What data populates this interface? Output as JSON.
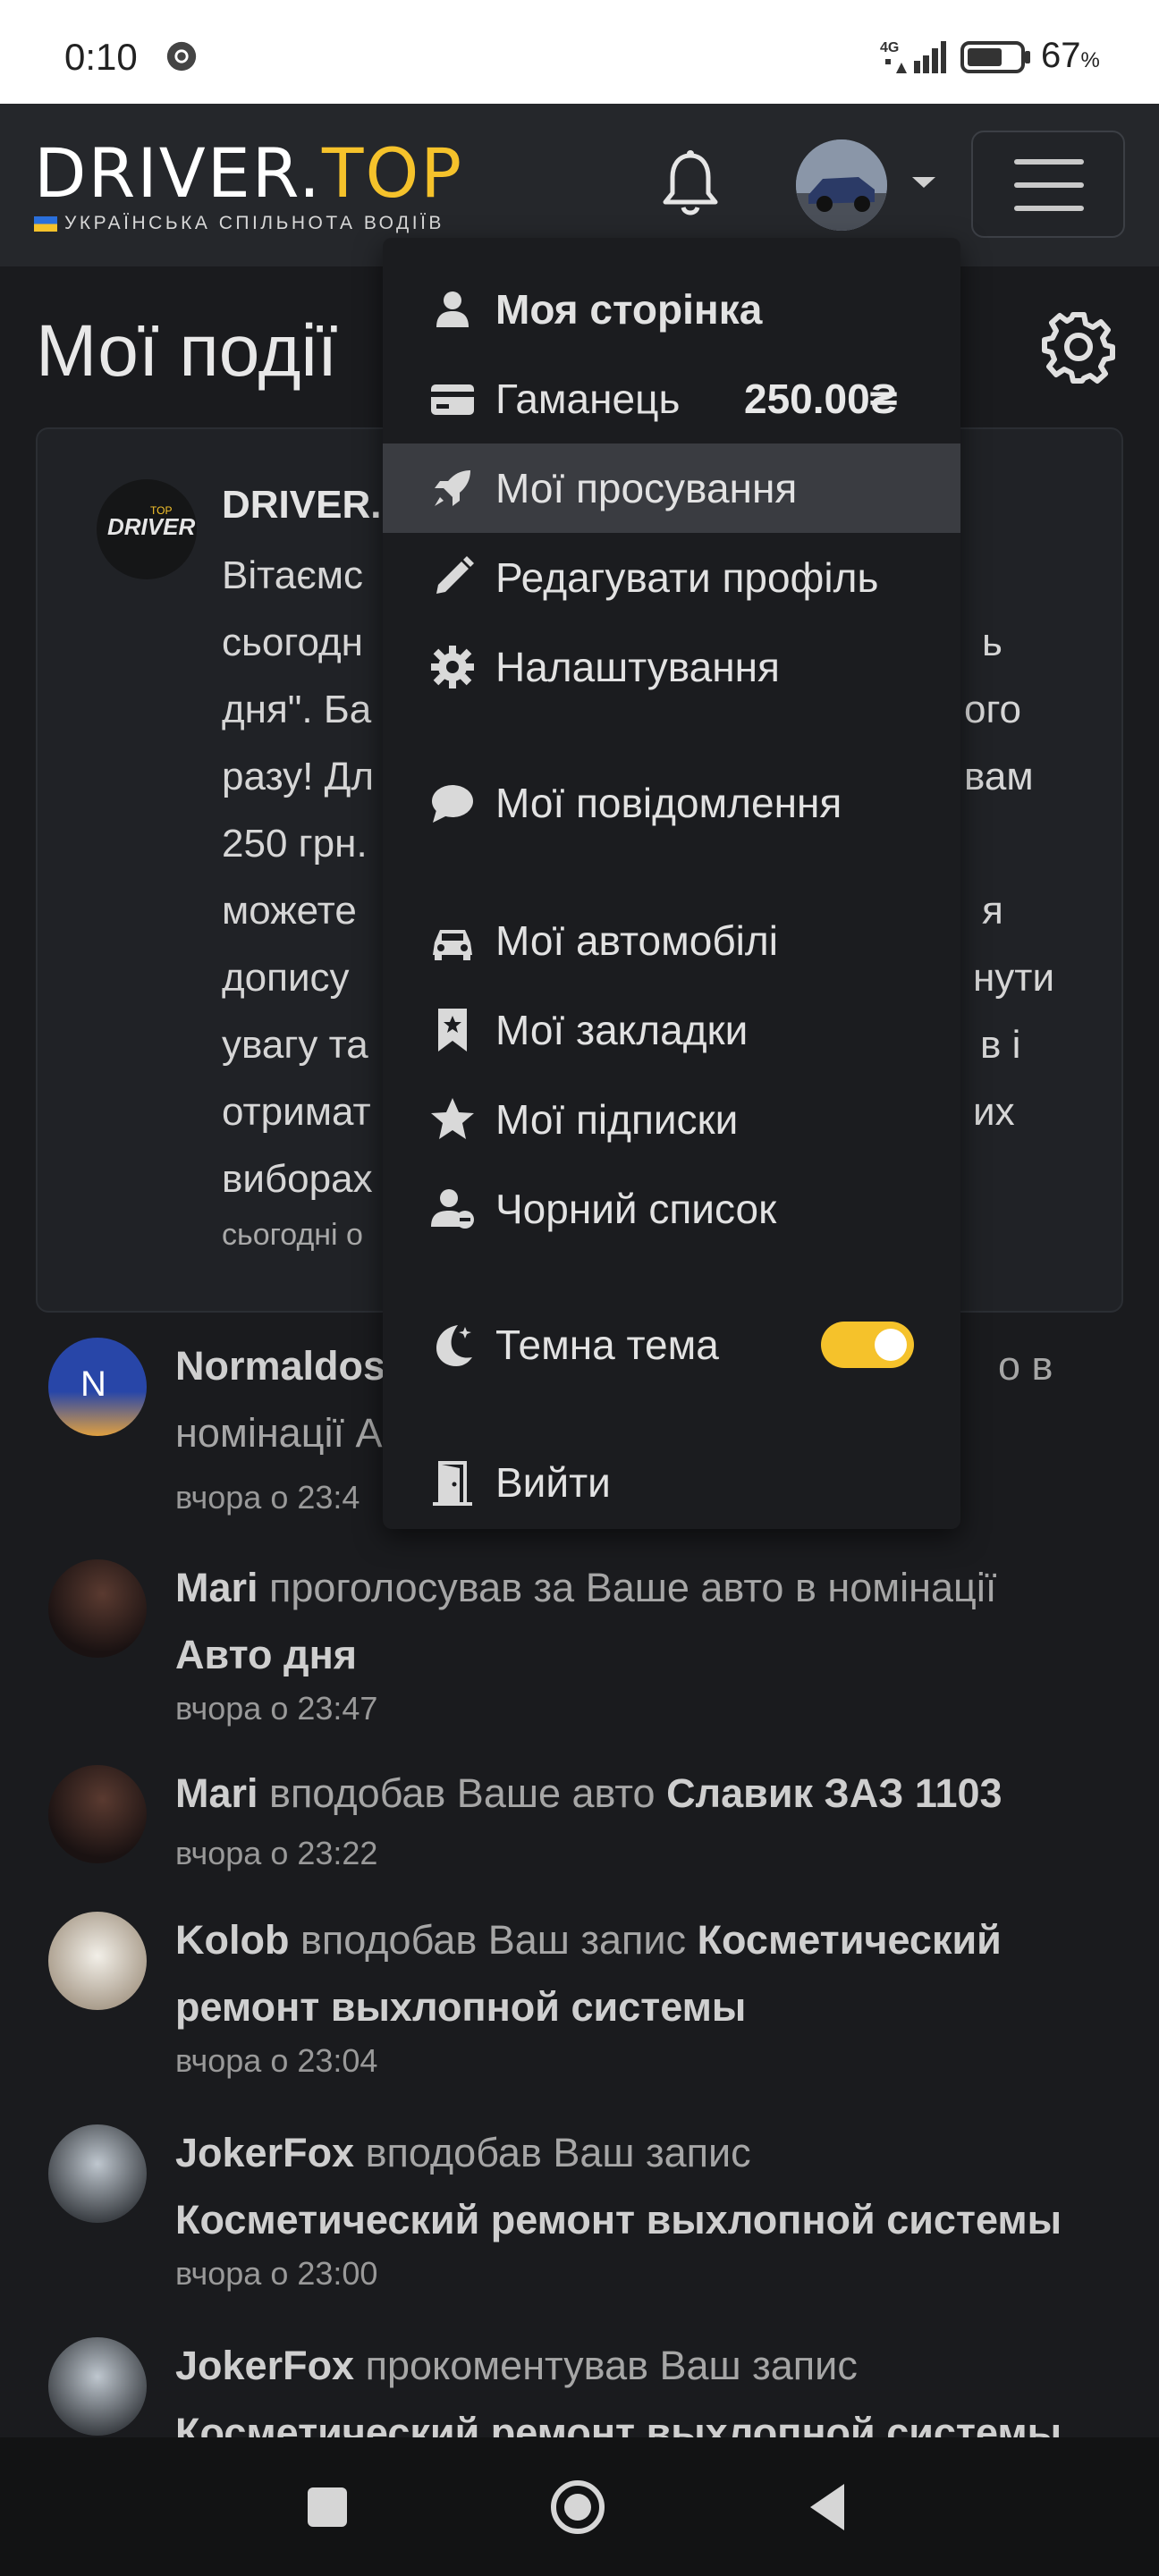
{
  "status_bar": {
    "time": "0:10",
    "network": "4G",
    "battery": "67",
    "battery_unit": "%"
  },
  "header": {
    "logo_left": "DRIVER.",
    "logo_right": "TOP",
    "tagline": "УКРАЇНСЬКА СПІЛЬНОТА ВОДІЇВ",
    "bell_icon": "bell-icon",
    "menu_icon": "hamburger-icon"
  },
  "page": {
    "title": "Мої події",
    "settings_icon": "gear-icon"
  },
  "card": {
    "author": "DRIVER.",
    "badge_text": "DRIVER",
    "badge_top": "TOP",
    "lines": [
      "Вітаємс",
      "сьогодн",
      "дня\". Ба",
      "разу! Дл",
      "250 грн.",
      "можете",
      "допису",
      "увагу та",
      "отримат",
      "виборах"
    ],
    "right_lines": [
      "",
      "ь",
      "ого",
      "вам",
      "",
      "я",
      "нути",
      "в і",
      "их",
      ""
    ],
    "time": "сьогодні о"
  },
  "feed": [
    {
      "user": "Normaldos",
      "action": "",
      "tail": "о в",
      "line2": "номінації А",
      "target": "",
      "time": "вчора о 23:4",
      "avatar": "N"
    },
    {
      "user": "Mari",
      "action": " проголосував за Ваше авто в номінації ",
      "target": "Авто дня",
      "time": "вчора о 23:47"
    },
    {
      "user": "Mari",
      "action": " вподобав Ваше авто ",
      "target": "Славик ЗАЗ 1103",
      "time": "вчора о 23:22"
    },
    {
      "user": "Kolob",
      "action": " вподобав Ваш запис ",
      "target": "Косметический ремонт выхлопной системы",
      "time": "вчора о 23:04"
    },
    {
      "user": "JokerFox",
      "action": " вподобав Ваш запис",
      "target": "Косметический ремонт выхлопной системы",
      "time": "вчора о 23:00"
    },
    {
      "user": "JokerFox",
      "action": " прокоментував Ваш запис",
      "target": "Косметический ремонт выхлопной системы",
      "time": ""
    }
  ],
  "dropdown": {
    "items": [
      {
        "label": "Моя сторінка",
        "icon": "user-icon"
      },
      {
        "label": "Гаманець",
        "icon": "wallet-icon",
        "value": "250.00₴"
      },
      {
        "label": "Мої просування",
        "icon": "rocket-icon"
      },
      {
        "label": "Редагувати профіль",
        "icon": "pencil-icon"
      },
      {
        "label": "Налаштування",
        "icon": "gear-icon"
      },
      {
        "label": "Мої повідомлення",
        "icon": "chat-icon"
      },
      {
        "label": "Мої автомобілі",
        "icon": "car-icon"
      },
      {
        "label": "Мої закладки",
        "icon": "bookmark-icon"
      },
      {
        "label": "Мої підписки",
        "icon": "star-icon"
      },
      {
        "label": "Чорний список",
        "icon": "user-block-icon"
      },
      {
        "label": "Темна тема",
        "icon": "moon-icon",
        "toggle": true
      },
      {
        "label": "Вийти",
        "icon": "door-icon"
      }
    ]
  },
  "colors": {
    "accent": "#f5c22b",
    "background": "#1a1b1e",
    "header": "#25272b"
  }
}
